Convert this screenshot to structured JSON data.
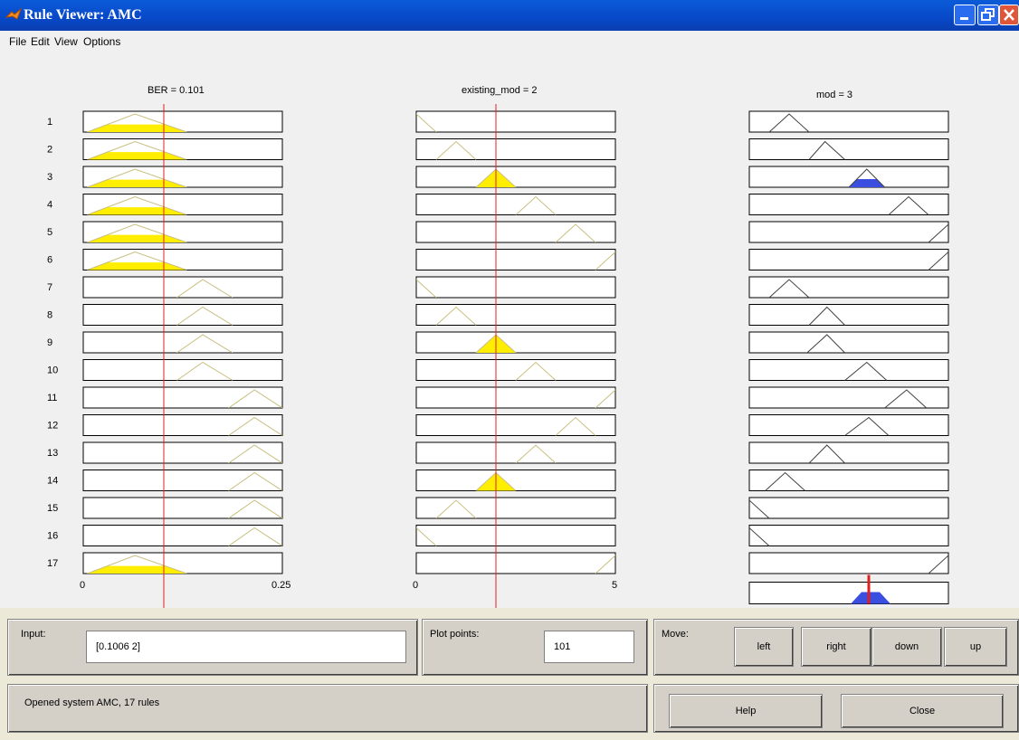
{
  "window": {
    "title": "Rule Viewer: AMC"
  },
  "menu": [
    "File",
    "Edit",
    "View",
    "Options"
  ],
  "variables": [
    {
      "label": "BER = 0.101",
      "axis_min": "0",
      "axis_max": "0.25"
    },
    {
      "label": "existing_mod = 2",
      "axis_min": "0",
      "axis_max": "5"
    },
    {
      "label": "mod = 3"
    }
  ],
  "rule_numbers": [
    "1",
    "2",
    "3",
    "4",
    "5",
    "6",
    "7",
    "8",
    "9",
    "10",
    "11",
    "12",
    "13",
    "14",
    "15",
    "16",
    "17"
  ],
  "input_panel": {
    "label": "Input:",
    "value": "[0.1006 2]"
  },
  "plot_points_panel": {
    "label": "Plot points:",
    "value": "101"
  },
  "move_panel": {
    "label": "Move:",
    "buttons": [
      "left",
      "right",
      "down",
      "up"
    ]
  },
  "status": {
    "text": "Opened system AMC, 17 rules"
  },
  "buttons": {
    "help": "Help",
    "close": "Close"
  },
  "colors": {
    "titlebar": "#0a4fd0",
    "fill_yellow": "#ffee00",
    "fill_blue": "#3a4fe0",
    "indicator_red": "#e02020",
    "mf_line": "#c8bf80"
  }
}
